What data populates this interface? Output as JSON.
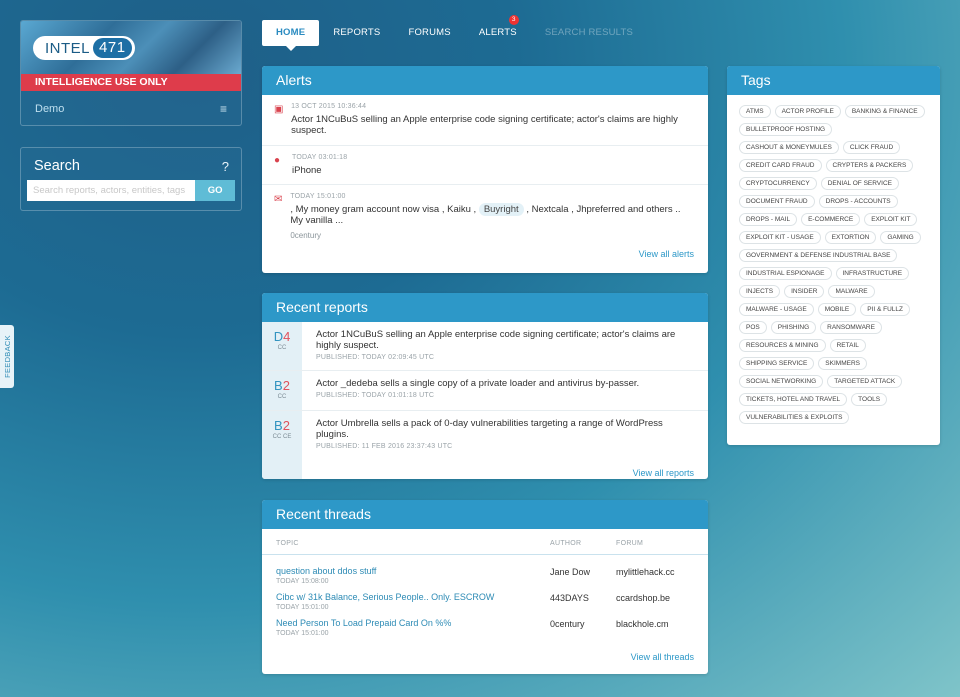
{
  "brand": {
    "logo_text": "INTEL",
    "logo_num": "471",
    "warning": "INTELLIGENCE USE ONLY",
    "user": "Demo",
    "menu_icon": "hamburger-icon"
  },
  "search": {
    "title": "Search",
    "help": "?",
    "placeholder": "Search reports, actors, entities, tags",
    "go": "GO"
  },
  "feedback": "FEEDBACK",
  "nav": {
    "home": "HOME",
    "reports": "REPORTS",
    "forums": "FORUMS",
    "alerts": "ALERTS",
    "alerts_badge": "3",
    "search_results": "SEARCH RESULTS"
  },
  "alerts": {
    "title": "Alerts",
    "items": [
      {
        "meta": "13 OCT 2015   10:36:44",
        "text": "Actor 1NCuBuS selling an Apple enterprise code signing certificate; actor's claims are highly suspect.",
        "icon": "report-icon"
      },
      {
        "meta": "TODAY   03:01:18",
        "text": "iPhone",
        "icon": "person-icon"
      },
      {
        "meta": "TODAY   15:01:00",
        "text_a": ", My money gram account now visa , Kaiku ,",
        "pill": "Buyright",
        "text_b": ", Nextcala , Jhpreferred and others .. My vanilla ...",
        "sub": "0century",
        "icon": "message-icon"
      }
    ],
    "view_all": "View all alerts"
  },
  "reports": {
    "title": "Recent reports",
    "items": [
      {
        "g1": "D",
        "g2": "4",
        "sub": "CC",
        "title": "Actor 1NCuBuS selling an Apple enterprise code signing certificate; actor's claims are highly suspect.",
        "meta": "PUBLISHED: TODAY   02:09:45 UTC"
      },
      {
        "g1": "B",
        "g2": "2",
        "sub": "CC",
        "title": "Actor _dedeba sells a single copy of a private loader and antivirus by-passer.",
        "meta": "PUBLISHED: TODAY   01:01:18 UTC"
      },
      {
        "g1": "B",
        "g2": "2",
        "sub": "CC CE",
        "title": "Actor Umbrella sells a pack of 0-day vulnerabilities targeting a range of WordPress plugins.",
        "meta": "PUBLISHED: 11 FEB 2016   23:37:43 UTC"
      }
    ],
    "view_all": "View all reports"
  },
  "threads": {
    "title": "Recent threads",
    "headers": {
      "topic": "TOPIC",
      "author": "AUTHOR",
      "forum": "FORUM"
    },
    "rows": [
      {
        "topic": "question about ddos stuff",
        "time": "TODAY   15:08:00",
        "author": "Jane Dow",
        "forum": "mylittlehack.cc"
      },
      {
        "topic": "Cibc w/ 31k Balance, Serious People.. Only. ESCROW",
        "time": "TODAY   15:01:00",
        "author": "443DAYS",
        "forum": "ccardshop.be"
      },
      {
        "topic": "Need Person To Load Prepaid Card On %%",
        "time": "TODAY   15:01:00",
        "author": "0century",
        "forum": "blackhole.cm"
      }
    ],
    "view_all": "View all threads"
  },
  "tags": {
    "title": "Tags",
    "items": [
      "ATMS",
      "ACTOR PROFILE",
      "BANKING & FINANCE",
      "BULLETPROOF HOSTING",
      "CASHOUT & MONEYMULES",
      "CLICK FRAUD",
      "CREDIT CARD FRAUD",
      "CRYPTERS & PACKERS",
      "CRYPTOCURRENCY",
      "DENIAL OF SERVICE",
      "DOCUMENT FRAUD",
      "DROPS - ACCOUNTS",
      "DROPS - MAIL",
      "E-COMMERCE",
      "EXPLOIT KIT",
      "EXPLOIT KIT - USAGE",
      "EXTORTION",
      "GAMING",
      "GOVERNMENT & DEFENSE INDUSTRIAL BASE",
      "INDUSTRIAL ESPIONAGE",
      "INFRASTRUCTURE",
      "INJECTS",
      "INSIDER",
      "MALWARE",
      "MALWARE - USAGE",
      "MOBILE",
      "PII & FULLZ",
      "POS",
      "PHISHING",
      "RANSOMWARE",
      "RESOURCES & MINING",
      "RETAIL",
      "SHIPPING SERVICE",
      "SKIMMERS",
      "SOCIAL NETWORKING",
      "TARGETED ATTACK",
      "TICKETS, HOTEL AND TRAVEL",
      "TOOLS",
      "VULNERABILITIES & EXPLOITS"
    ]
  }
}
